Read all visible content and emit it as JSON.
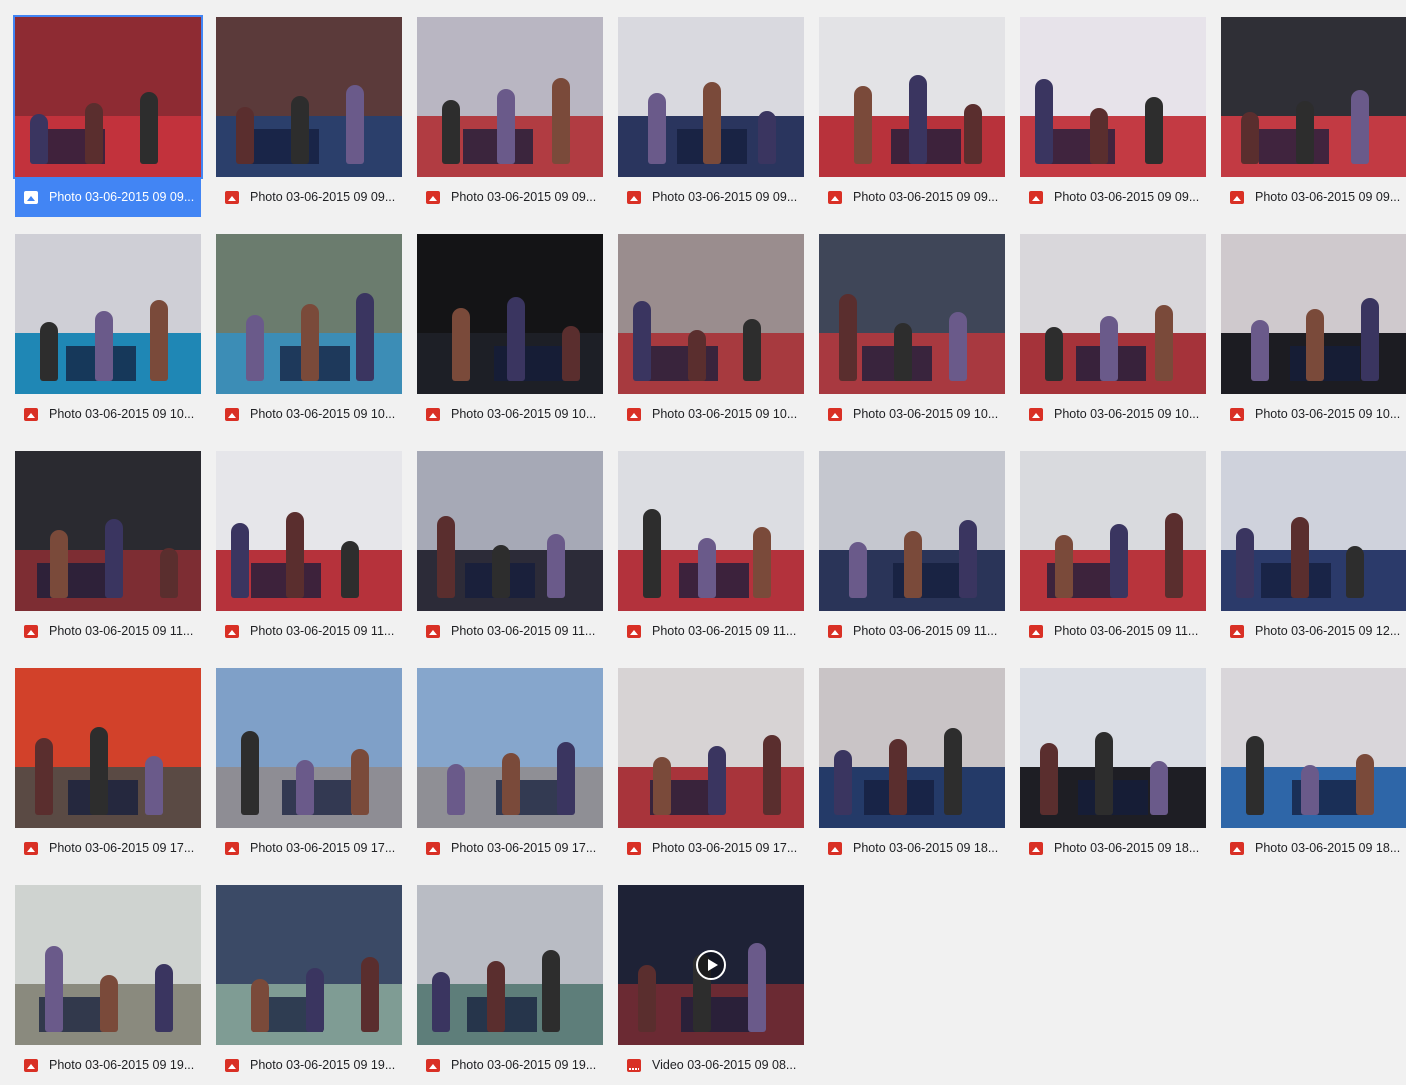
{
  "colors": {
    "selection": "#4285f4",
    "file_icon": "#d93025"
  },
  "files": [
    {
      "name": "Photo 03-06-2015 09 09...",
      "type": "photo",
      "selected": true,
      "bg": "#8e2b33",
      "floor": "#c2323c"
    },
    {
      "name": "Photo 03-06-2015 09 09...",
      "type": "photo",
      "bg": "#5b3a3a",
      "floor": "#2b3f6b"
    },
    {
      "name": "Photo 03-06-2015 09 09...",
      "type": "photo",
      "bg": "#b9b6c2",
      "floor": "#b13c42"
    },
    {
      "name": "Photo 03-06-2015 09 09...",
      "type": "photo",
      "bg": "#d9d9df",
      "floor": "#2a355e"
    },
    {
      "name": "Photo 03-06-2015 09 09...",
      "type": "photo",
      "bg": "#e3e3e6",
      "floor": "#b8323b"
    },
    {
      "name": "Photo 03-06-2015 09 09...",
      "type": "photo",
      "bg": "#e7e3ea",
      "floor": "#c33a43"
    },
    {
      "name": "Photo 03-06-2015 09 09...",
      "type": "photo",
      "bg": "#2f2f36",
      "floor": "#c23a43"
    },
    {
      "name": "Photo 03-06-2015 09 10...",
      "type": "photo",
      "bg": "#cfcfd6",
      "floor": "#1f87b5"
    },
    {
      "name": "Photo 03-06-2015 09 10...",
      "type": "photo",
      "bg": "#6b7c6e",
      "floor": "#3c8db6"
    },
    {
      "name": "Photo 03-06-2015 09 10...",
      "type": "photo",
      "bg": "#141416",
      "floor": "#1d1f26"
    },
    {
      "name": "Photo 03-06-2015 09 10...",
      "type": "photo",
      "bg": "#9a8d8e",
      "floor": "#a73a3f"
    },
    {
      "name": "Photo 03-06-2015 09 10...",
      "type": "photo",
      "bg": "#3f4658",
      "floor": "#a83940"
    },
    {
      "name": "Photo 03-06-2015 09 10...",
      "type": "photo",
      "bg": "#d9d7db",
      "floor": "#a5333a"
    },
    {
      "name": "Photo 03-06-2015 09 10...",
      "type": "photo",
      "bg": "#cfc9cd",
      "floor": "#1c1c22"
    },
    {
      "name": "Photo 03-06-2015 09 11...",
      "type": "photo",
      "bg": "#2a2a30",
      "floor": "#7d2d33"
    },
    {
      "name": "Photo 03-06-2015 09 11...",
      "type": "photo",
      "bg": "#e6e6ea",
      "floor": "#b6323b"
    },
    {
      "name": "Photo 03-06-2015 09 11...",
      "type": "photo",
      "bg": "#a6a9b6",
      "floor": "#2c2b38"
    },
    {
      "name": "Photo 03-06-2015 09 11...",
      "type": "photo",
      "bg": "#dcdde2",
      "floor": "#b3323c"
    },
    {
      "name": "Photo 03-06-2015 09 11...",
      "type": "photo",
      "bg": "#c5c7cf",
      "floor": "#2a3458"
    },
    {
      "name": "Photo 03-06-2015 09 11...",
      "type": "photo",
      "bg": "#d9dade",
      "floor": "#b8343c"
    },
    {
      "name": "Photo 03-06-2015 09 12...",
      "type": "photo",
      "bg": "#cfd2dc",
      "floor": "#2b3a6a"
    },
    {
      "name": "Photo 03-06-2015 09 17...",
      "type": "photo",
      "bg": "#d2412a",
      "floor": "#5a4a44"
    },
    {
      "name": "Photo 03-06-2015 09 17...",
      "type": "photo",
      "bg": "#7fa0c8",
      "floor": "#8e8d94"
    },
    {
      "name": "Photo 03-06-2015 09 17...",
      "type": "photo",
      "bg": "#86a6cc",
      "floor": "#8f8f95"
    },
    {
      "name": "Photo 03-06-2015 09 17...",
      "type": "photo",
      "bg": "#d7d3d4",
      "floor": "#a8343b"
    },
    {
      "name": "Photo 03-06-2015 09 18...",
      "type": "photo",
      "bg": "#c9c4c6",
      "floor": "#243a68"
    },
    {
      "name": "Photo 03-06-2015 09 18...",
      "type": "photo",
      "bg": "#dadde4",
      "floor": "#1e1e24"
    },
    {
      "name": "Photo 03-06-2015 09 18...",
      "type": "photo",
      "bg": "#d9d6da",
      "floor": "#2e66a8"
    },
    {
      "name": "Photo 03-06-2015 09 19...",
      "type": "photo",
      "bg": "#cfd3d0",
      "floor": "#8a8a7e"
    },
    {
      "name": "Photo 03-06-2015 09 19...",
      "type": "photo",
      "bg": "#3b4a66",
      "floor": "#7f9c94"
    },
    {
      "name": "Photo 03-06-2015 09 19...",
      "type": "photo",
      "bg": "#b9bcc4",
      "floor": "#5e7e7a"
    },
    {
      "name": "Video 03-06-2015 09 08...",
      "type": "video",
      "bg": "#1e2236",
      "floor": "#6b2a33"
    }
  ]
}
